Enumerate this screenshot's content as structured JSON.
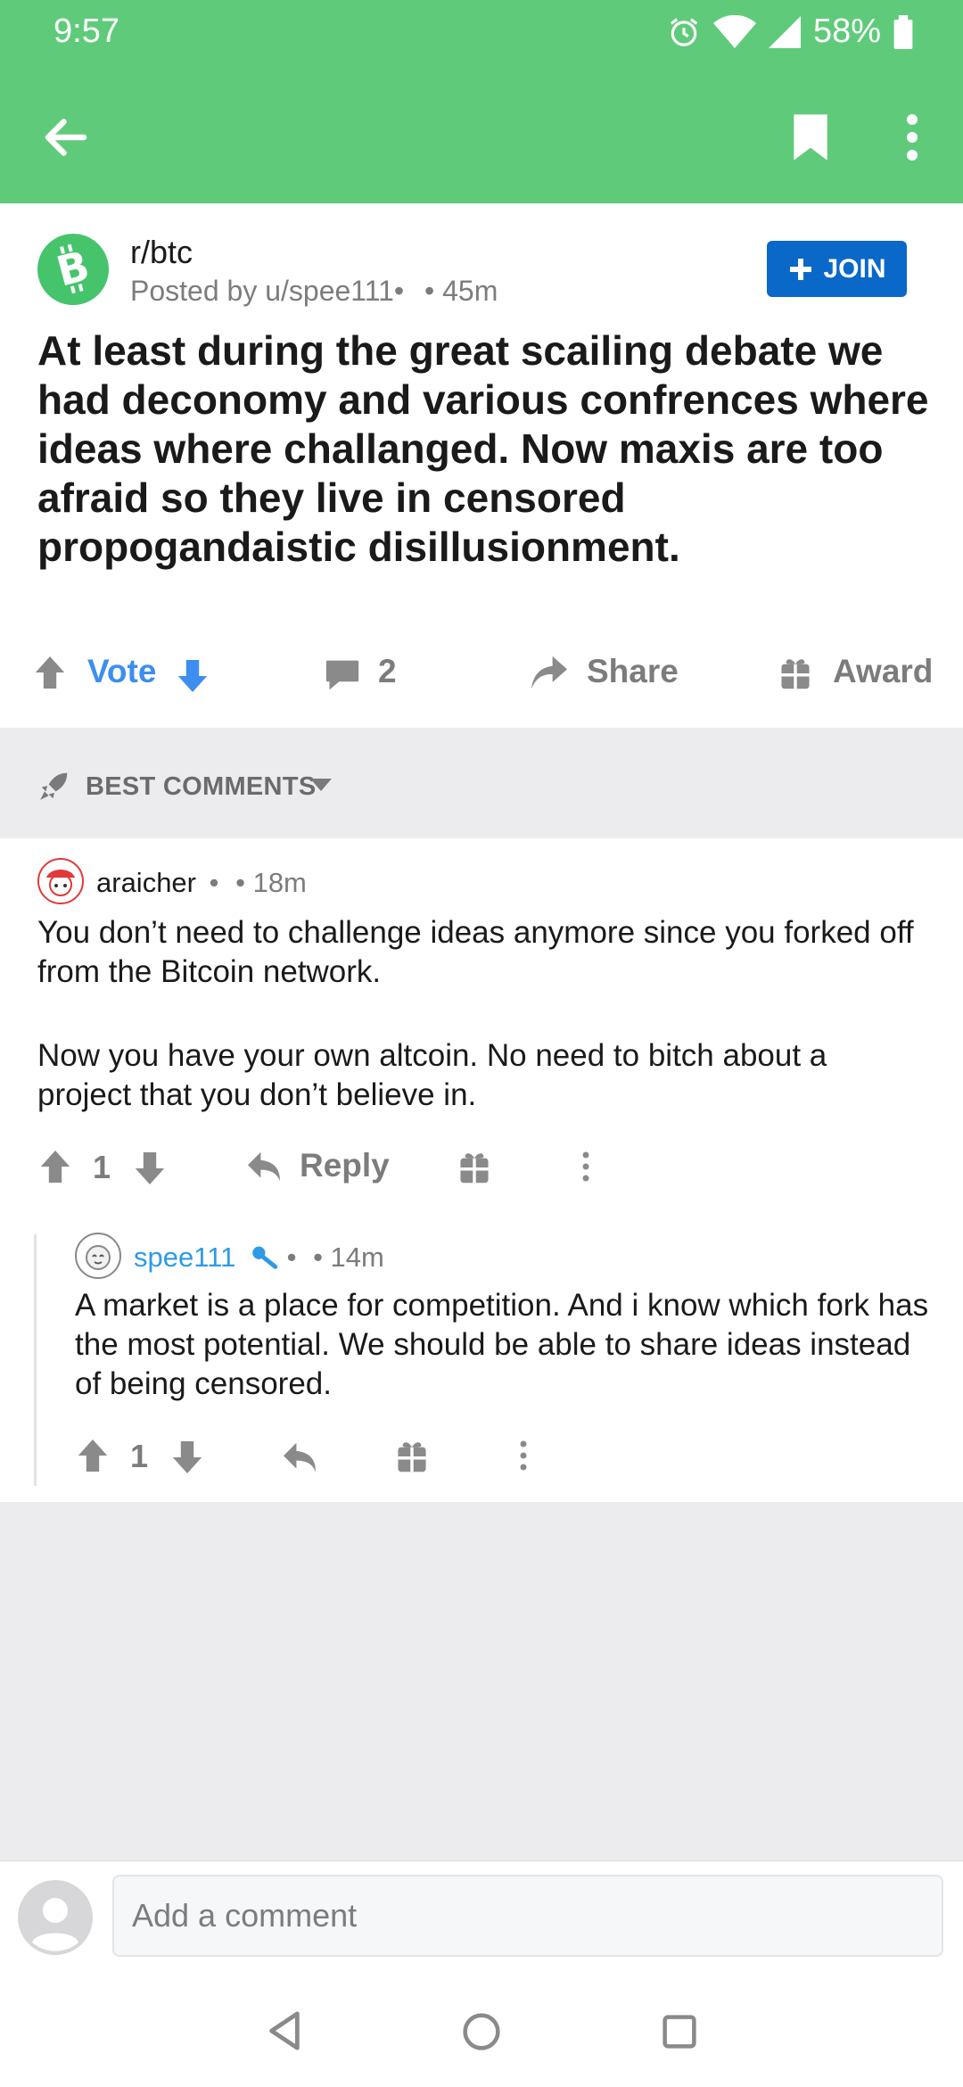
{
  "status": {
    "time": "9:57",
    "battery": "58%"
  },
  "post": {
    "subreddit": "r/btc",
    "posted_by": "Posted by u/spee111•",
    "age": "• 45m",
    "join_label": "JOIN",
    "title": "At least during the great scailing debate we had deconomy and various confrences where ideas where challanged. Now maxis are too afraid so they live in censored propogandaistic disillusionment.",
    "vote_label": "Vote",
    "comment_count": "2",
    "share_label": "Share",
    "award_label": "Award"
  },
  "comments_header": {
    "sort_label": "BEST COMMENTS"
  },
  "comments": [
    {
      "author": "araicher",
      "sep": "•",
      "age": "• 18m",
      "paragraphs": [
        "You don’t need to challenge ideas anymore since you forked off from the Bitcoin network.",
        "Now you have your own altcoin. No need to bitch about a project that you don’t believe in."
      ],
      "score": "1",
      "reply_label": "Reply"
    },
    {
      "author": "spee111",
      "sep": "•",
      "age": "• 14m",
      "paragraphs": [
        "A market is a place for competition. And i know which fork has the most potential. We should be able to share ideas instead of being censored."
      ],
      "score": "1"
    }
  ],
  "comment_input": {
    "placeholder": "Add a comment"
  },
  "colors": {
    "header": "#5fcb7a",
    "join": "#0a68c9",
    "vote_blue": "#3d8ef0",
    "op_blue": "#2e9ae6"
  }
}
